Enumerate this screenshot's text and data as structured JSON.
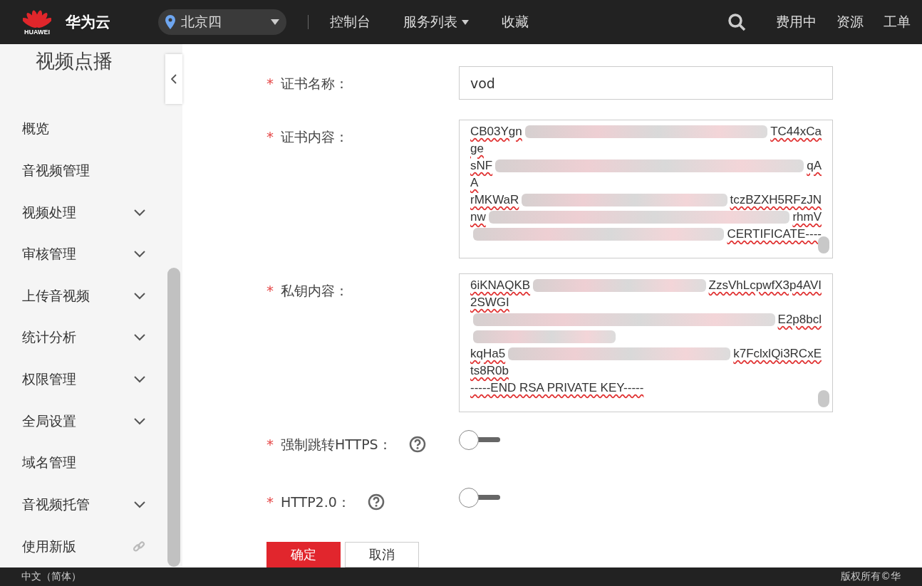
{
  "header": {
    "logo_text": "HUAWEI",
    "brand": "华为云",
    "region": "北京四",
    "nav": [
      {
        "label": "控制台",
        "dropdown": false
      },
      {
        "label": "服务列表",
        "dropdown": true
      },
      {
        "label": "收藏",
        "dropdown": false
      }
    ],
    "right_links": [
      "费用中",
      "资源",
      "工单"
    ]
  },
  "sidebar": {
    "title": "视频点播",
    "items": [
      {
        "label": "概览",
        "kind": "plain"
      },
      {
        "label": "音视频管理",
        "kind": "plain"
      },
      {
        "label": "视频处理",
        "kind": "group"
      },
      {
        "label": "审核管理",
        "kind": "group"
      },
      {
        "label": "上传音视频",
        "kind": "group"
      },
      {
        "label": "统计分析",
        "kind": "group"
      },
      {
        "label": "权限管理",
        "kind": "group"
      },
      {
        "label": "全局设置",
        "kind": "group"
      },
      {
        "label": "域名管理",
        "kind": "plain"
      },
      {
        "label": "音视频托管",
        "kind": "group"
      },
      {
        "label": "使用新版",
        "kind": "external"
      }
    ]
  },
  "form": {
    "fields": [
      {
        "kind": "input",
        "label": "证书名称：",
        "required_mark": "*",
        "value": "vod"
      },
      {
        "kind": "textarea",
        "label": "证书内容：",
        "required_mark": "*",
        "lines": [
          {
            "left": "CB03Ygn",
            "right": "TC44xCa"
          },
          {
            "left": "ge"
          },
          {
            "left": "sNF",
            "right": "qA"
          },
          {
            "left": "A"
          },
          {
            "left": "rMKWaR",
            "right": "tczBZXH5RFzJN"
          },
          {
            "left": "nw",
            "right": "rhmV"
          },
          {
            "right": "CERTIFICATE----"
          }
        ]
      },
      {
        "kind": "textarea",
        "label": "私钥内容：",
        "required_mark": "*",
        "lines": [
          {
            "left": "6iKNAQKB",
            "right": "ZzsVhLcpwfX3p4AVI"
          },
          {
            "left": "2SWGI"
          },
          {
            "right": "E2p8bcl"
          },
          {
            "kind": "redacted"
          },
          {
            "left": "kqHa5",
            "right": "k7FclxlQi3RCxE"
          },
          {
            "left": "ts8R0b"
          },
          {
            "left": "-----END RSA PRIVATE KEY-----"
          }
        ]
      },
      {
        "kind": "switch",
        "label": "强制跳转HTTPS：",
        "required_mark": "*",
        "help": true,
        "on": false
      },
      {
        "kind": "switch",
        "label": "HTTP2.0：",
        "required_mark": "*",
        "help": true,
        "on": false
      }
    ],
    "buttons": [
      {
        "label": "确定",
        "kind": "primary"
      },
      {
        "label": "取消",
        "kind": "secondary"
      }
    ]
  },
  "footer": {
    "language": "中文（简体）",
    "copyright": "版权所有©华"
  }
}
